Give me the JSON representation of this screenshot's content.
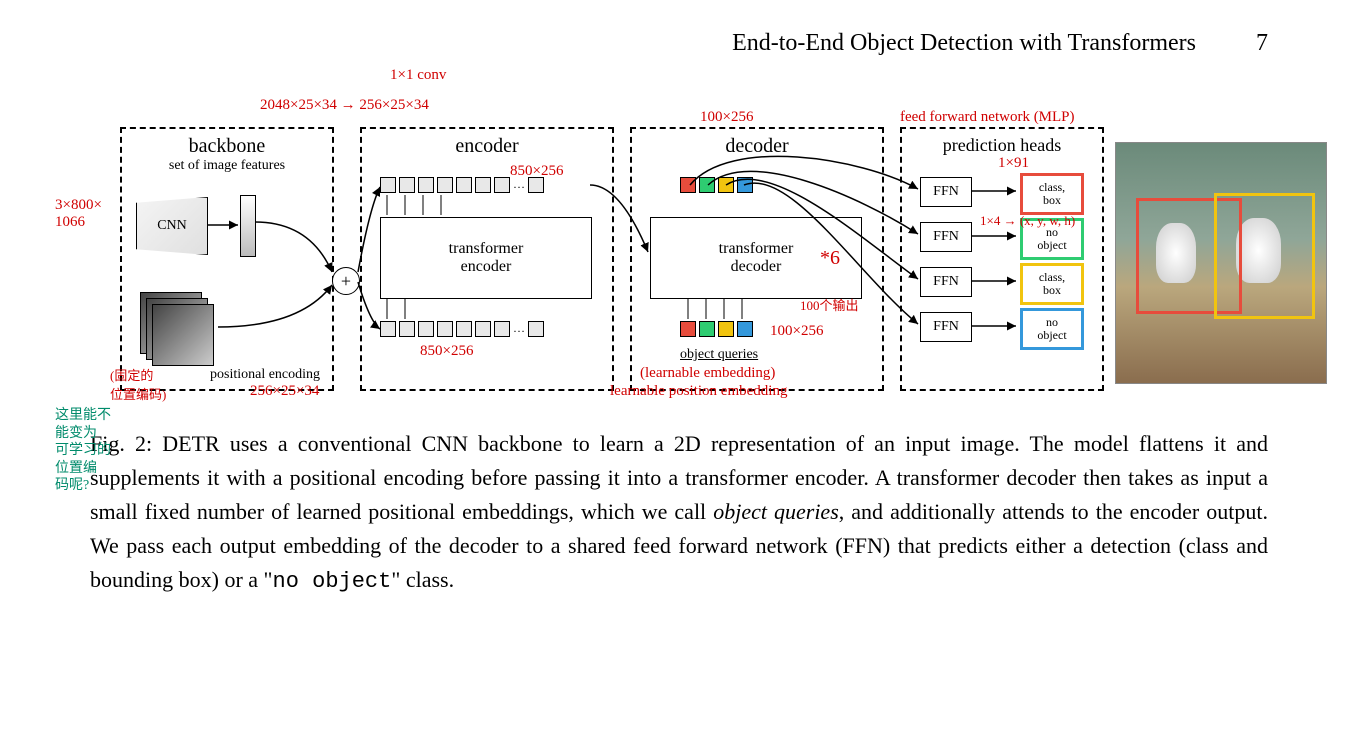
{
  "header": {
    "title": "End-to-End Object Detection with Transformers",
    "page": "7"
  },
  "diagram": {
    "backbone": {
      "title": "backbone",
      "sub": "set of image features",
      "cnn": "CNN",
      "posenc": "positional encoding"
    },
    "encoder": {
      "title": "encoder",
      "box": "transformer\nencoder"
    },
    "decoder": {
      "title": "decoder",
      "box": "transformer\ndecoder",
      "objq": "object queries"
    },
    "pred": {
      "title": "prediction heads",
      "ffn": "FFN",
      "out1": "class,\nbox",
      "out2": "no\nobject",
      "out3": "class,\nbox",
      "out4": "no\nobject"
    }
  },
  "annot": {
    "conv": "1×1 conv",
    "dims1": "2048×25×34 → 256×25×34",
    "imgdim": "3×800×\n1066",
    "encrow_top": "850×256",
    "encrow_bot": "850×256",
    "posdim": "256×25×34",
    "fixedpos": "(固定的\n位置编码)",
    "question": "这里能不\n能变为\n可学习的\n位置编\n码呢?",
    "dec100": "100×256",
    "times6": "*6",
    "decout": "100个输出",
    "decin": "100×256",
    "learn1": "(learnable embedding)",
    "learn2": "learnable position embedding",
    "ffnlabel": "feed forward network (MLP)",
    "cls91": "1×91",
    "box4": "1×4 → (x, y, w, h)"
  },
  "caption": {
    "fig": "Fig. 2:",
    "text1": "DETR uses a conventional CNN backbone to learn a 2D representation of an input image. The model flattens it and supplements it with a positional encoding before passing it into a transformer encoder. A transformer decoder then takes as input a small fixed number of learned positional embeddings, which we call ",
    "obj_queries": "object queries",
    "text2": ", and additionally attends to the encoder output. We pass each output embedding of the decoder to a shared feed forward network (FFN) that predicts either a detection (class and bounding box) or a \"",
    "noobj": "no object",
    "text3": "\" class."
  }
}
